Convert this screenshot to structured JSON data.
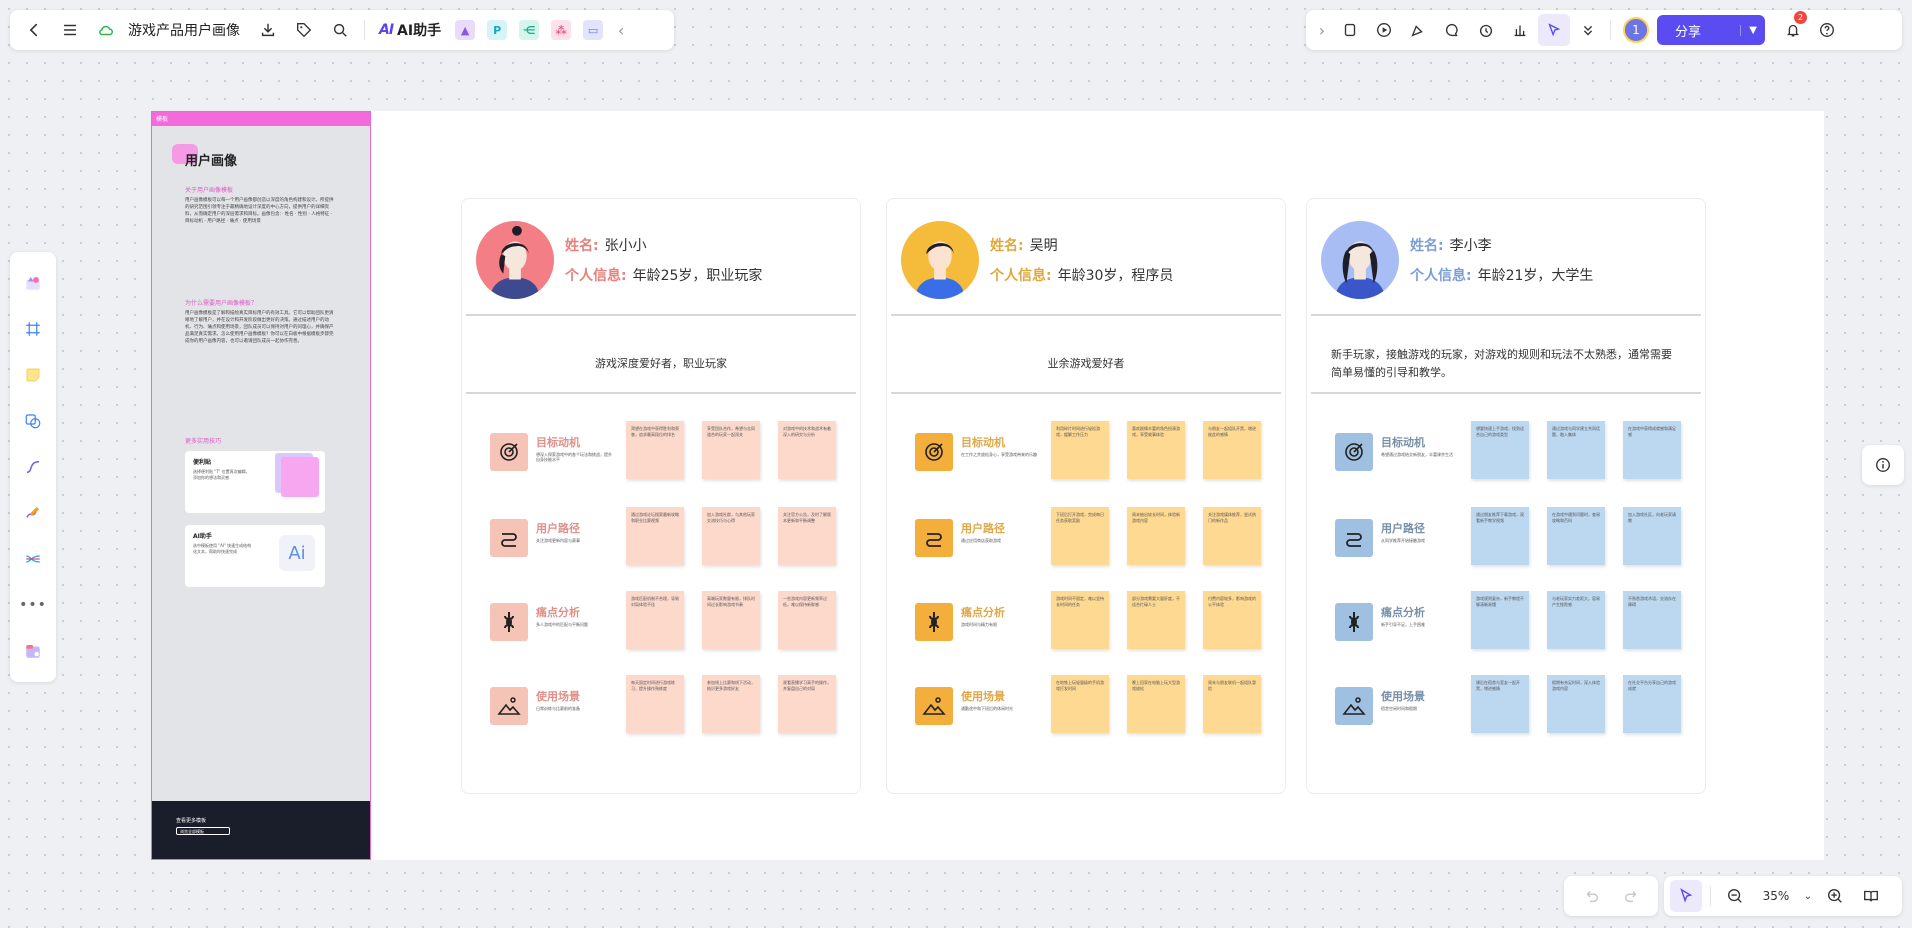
{
  "toolbar": {
    "doc_title": "游戏产品用户画像",
    "ai_label": "AI助手",
    "ai_logo": "AI",
    "plugin_p": "P"
  },
  "topright": {
    "avatar_text": "1",
    "share_label": "分享",
    "notify_count": "2"
  },
  "zoom": {
    "level": "35%"
  },
  "template_panel": {
    "header": "模板",
    "title": "用户画像",
    "section1": "关于用户画像模板",
    "section1_text": "用户画像模板可以每一个用户画像都创造以深度的角色构建和设计。所提供的研究范围引领专注于最精确地设计深度的中心方向，提供用户的详细资料，从而确定用户的深层需求和目标。画像包含：· 姓名 · 性别 · 人格特征 · 目标动机 · 用户路径 · 痛点 · 使用场景",
    "section2": "为什么需要用户画像模板？",
    "section2_text": "用户画像模板是了解和描绘真实目标用户的有效工具。它可以帮助团队更清晰地了解用户，并在设计和开发阶段做出更好的决策。通过描述用户的动机、行为、痛点和使用场景，团队成员可以保持对用户的同理心，并确保产品满足真实需求。怎么使用用户画像模板？你可以在白板中根据模板步骤完成你的用户画像内容，也可以邀请团队成员一起协作完善。",
    "section3": "更多实用技巧",
    "card1_name": "便利贴",
    "card1_desc": "选择便利贴 \"T\" 位置再次编辑，添加你的想法和灵感",
    "card2_name": "AI助手",
    "card2_desc": "选中模板使用 \"AI\" 快速生成结构化文本，帮助你快速完成",
    "card2_icon": "Ai",
    "footer_title": "查看更多模板",
    "footer_btn": "浏览全部模板"
  },
  "labels": {
    "name": "姓名:",
    "info": "个人信息:"
  },
  "personas": [
    {
      "name": "张小小",
      "info": "年龄25岁，职业玩家",
      "desc": "游戏深度爱好者，职业玩家",
      "label_color": "#e8807c",
      "avatar_bg": "#f37e86",
      "row_icon_bg": "#f5c4b7",
      "row_title_color": "#e0908a",
      "note_color": "#fdd9cc",
      "rows": [
        {
          "title": "目标动机",
          "sub": "想深入探索游戏中的各个玩法和挑战，提升自身技能水平",
          "notes": [
            "渴望在游戏中获得胜利和荣誉，追求最高段位的排名",
            "享受团队合作，希望与志同道合的玩家一起闯关",
            "对游戏中的技术和战术有着深入的研究与分析"
          ]
        },
        {
          "title": "用户路径",
          "sub": "关注游戏更新内容与赛事",
          "notes": [
            "通过游戏论坛搜索最新攻略和职业比赛视频",
            "加入游戏社群，与其他玩家交流技巧与心得",
            "关注官方公告，及时了解版本更新和平衡调整"
          ]
        },
        {
          "title": "痛点分析",
          "sub": "多人游戏中的匹配与平衡问题",
          "notes": [
            "游戏匹配机制不合理，导致对局体验不佳",
            "高端玩家数量有限，排队时间过长影响游戏节奏",
            "一些游戏内容更新频率过低，难以保持新鲜感"
          ]
        },
        {
          "title": "使用场景",
          "sub": "日常训练与比赛前的准备",
          "notes": [
            "每天固定时间进行游戏练习，提升操作熟练度",
            "参加线上比赛和线下活动，结识更多游戏好友",
            "观看直播学习高手的操作，并复盘自己的对局"
          ]
        }
      ]
    },
    {
      "name": "吴明",
      "info": "年龄30岁，程序员",
      "desc": "业余游戏爱好者",
      "label_color": "#e0a73a",
      "avatar_bg": "#f5bc3c",
      "row_icon_bg": "#f3ae3c",
      "row_title_color": "#e0a74a",
      "note_color": "#fed992",
      "rows": [
        {
          "title": "目标动机",
          "sub": "在工作之余放松身心，享受游戏带来的乐趣",
          "notes": [
            "利用碎片时间进行轻松游戏，缓解工作压力",
            "喜欢剧情丰富的角色扮演游戏，享受故事体验",
            "与朋友一起组队开黑，增进彼此的感情"
          ]
        },
        {
          "title": "用户路径",
          "sub": "通过应用商店获取游戏",
          "notes": [
            "下班后打开游戏，完成每日任务获取奖励",
            "周末抽出较长时间，体验新游戏内容",
            "关注游戏媒体推荐，尝试热门的新作品"
          ]
        },
        {
          "title": "痛点分析",
          "sub": "游戏时间与精力有限",
          "notes": [
            "游戏时间不固定，难以坚持长时间的任务",
            "部分游戏需要大量肝度，不适合忙碌人士",
            "付费内容较多，影响游戏的公平体验"
          ]
        },
        {
          "title": "使用场景",
          "sub": "通勤途中和下班后的休闲时光",
          "notes": [
            "在地铁上玩轻量级的手机游戏打发时间",
            "晚上回家在电脑上玩大型游戏放松",
            "周末与朋友联机一起组队冒险"
          ]
        }
      ]
    },
    {
      "name": "李小李",
      "info": "年龄21岁，大学生",
      "desc": "新手玩家，接触游戏的玩家，对游戏的规则和玩法不太熟悉，通常需要简单易懂的引导和教学。",
      "label_color": "#7b9ed6",
      "avatar_bg": "#a9bdf5",
      "row_icon_bg": "#9fc0e0",
      "row_title_color": "#7890a8",
      "note_color": "#bcd7f0",
      "rows": [
        {
          "title": "目标动机",
          "sub": "希望通过游戏结交新朋友，丰富课余生活",
          "notes": [
            "想要快速上手游戏，找到适合自己的游戏类型",
            "通过游戏与同学建立共同话题，融入集体",
            "在游戏中获得成就感和满足感"
          ]
        },
        {
          "title": "用户路径",
          "sub": "从同学推荐开始接触游戏",
          "notes": [
            "通过朋友推荐下载游戏，观看新手教学视频",
            "在游戏中遇到问题时，查阅攻略和百科",
            "加入游戏社区，向老玩家请教"
          ]
        },
        {
          "title": "痛点分析",
          "sub": "新手引导不足，上手困难",
          "notes": [
            "游戏规则复杂，新手教程不够清晰易懂",
            "与老玩家实力差距大，容易产生挫败感",
            "不熟悉游戏术语，交流存在障碍"
          ]
        },
        {
          "title": "使用场景",
          "sub": "宿舍空闲时间和假期",
          "notes": [
            "课后在宿舍与室友一起开黑，增进感情",
            "假期有充足时间，深入体验游戏内容",
            "在社交平台分享自己的游戏成就"
          ]
        }
      ]
    }
  ]
}
